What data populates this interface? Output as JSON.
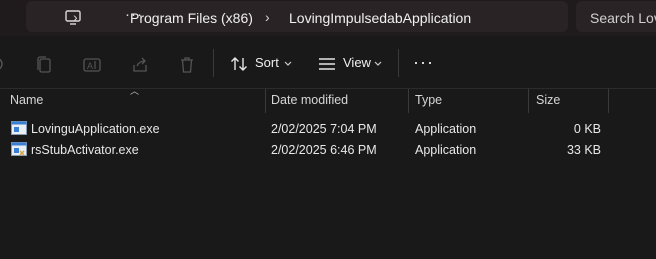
{
  "address_bar": {
    "breadcrumbs": [
      "Program Files (x86)",
      "LovingImpulsedabApplication"
    ],
    "overflow": "···",
    "search_placeholder": "Search Lov"
  },
  "toolbar": {
    "sort_label": "Sort",
    "view_label": "View",
    "more_label": "···"
  },
  "columns": [
    "Name",
    "Date modified",
    "Type",
    "Size"
  ],
  "files": [
    {
      "name": "LovinguApplication.exe",
      "date": "2/02/2025 7:04 PM",
      "type": "Application",
      "size": "0 KB"
    },
    {
      "name": "rsStubActivator.exe",
      "date": "2/02/2025 6:46 PM",
      "type": "Application",
      "size": "33 KB"
    }
  ],
  "colors": {
    "background": "#191919",
    "address_bg": "#2a2326",
    "icon_blue": "#3b7fd4"
  }
}
